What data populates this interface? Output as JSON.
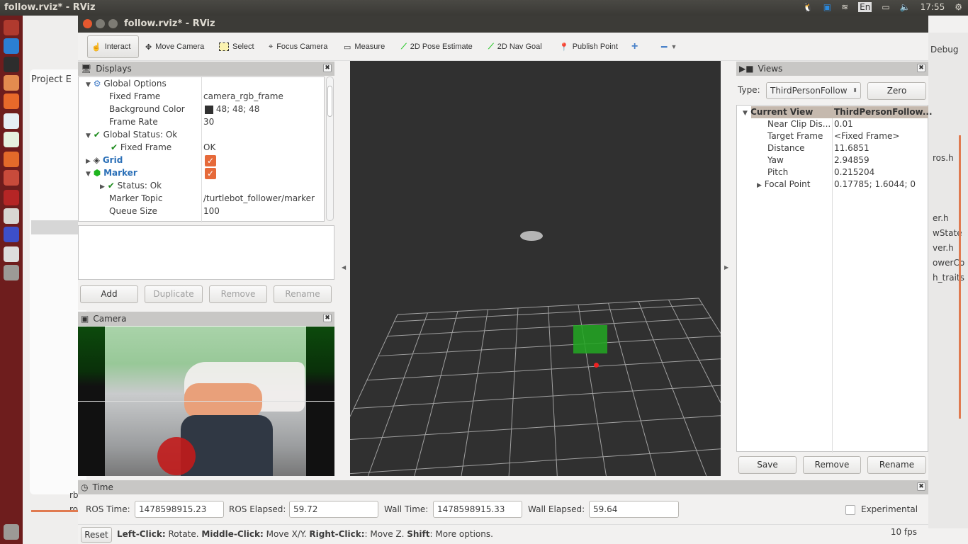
{
  "topbar": {
    "title": "follow.rviz* - RViz",
    "lang": "En",
    "clock": "17:55"
  },
  "window": {
    "title": "follow.rviz* - RViz"
  },
  "eclipse": {
    "project_label": "Project E",
    "debug_label": "Debug",
    "files": [
      "ros.h",
      "er.h",
      "wState",
      "ver.h",
      "owerCo",
      "h_traits",
      "rb",
      "ro"
    ]
  },
  "toolbar": {
    "tools": [
      {
        "label": "Interact",
        "icon": "hand-icon"
      },
      {
        "label": "Move Camera",
        "icon": "move-icon"
      },
      {
        "label": "Select",
        "icon": "select-icon"
      },
      {
        "label": "Focus Camera",
        "icon": "focus-icon"
      },
      {
        "label": "Measure",
        "icon": "ruler-icon"
      },
      {
        "label": "2D Pose Estimate",
        "icon": "green-arrow-icon"
      },
      {
        "label": "2D Nav Goal",
        "icon": "green-arrow-icon"
      },
      {
        "label": "Publish Point",
        "icon": "map-pin-icon"
      }
    ]
  },
  "displays": {
    "title": "Displays",
    "rows": [
      {
        "name": "Global Options",
        "value": ""
      },
      {
        "name": "Fixed Frame",
        "value": "camera_rgb_frame"
      },
      {
        "name": "Background Color",
        "value": "48; 48; 48"
      },
      {
        "name": "Frame Rate",
        "value": "30"
      },
      {
        "name": "Global Status: Ok",
        "value": ""
      },
      {
        "name": "Fixed Frame",
        "value": "OK"
      },
      {
        "name": "Grid",
        "value": ""
      },
      {
        "name": "Marker",
        "value": ""
      },
      {
        "name": "Status: Ok",
        "value": ""
      },
      {
        "name": "Marker Topic",
        "value": "/turtlebot_follower/marker"
      },
      {
        "name": "Queue Size",
        "value": "100"
      }
    ],
    "grid_enabled": true,
    "marker_enabled": true,
    "background_color": "#303030",
    "buttons": {
      "add": "Add",
      "duplicate": "Duplicate",
      "remove": "Remove",
      "rename": "Rename"
    }
  },
  "camera": {
    "title": "Camera"
  },
  "views": {
    "title": "Views",
    "type_label": "Type:",
    "type_value": "ThirdPersonFollow",
    "zero": "Zero",
    "header": {
      "name": "Current View",
      "value": "ThirdPersonFollow..."
    },
    "rows": [
      {
        "name": "Near Clip Dis...",
        "value": "0.01"
      },
      {
        "name": "Target Frame",
        "value": "<Fixed Frame>"
      },
      {
        "name": "Distance",
        "value": "11.6851"
      },
      {
        "name": "Yaw",
        "value": "2.94859"
      },
      {
        "name": "Pitch",
        "value": "0.215204"
      },
      {
        "name": "Focal Point",
        "value": "0.17785; 1.6044; 0"
      }
    ],
    "buttons": {
      "save": "Save",
      "remove": "Remove",
      "rename": "Rename"
    }
  },
  "time": {
    "title": "Time",
    "ros_time_label": "ROS Time:",
    "ros_time": "1478598915.23",
    "ros_elapsed_label": "ROS Elapsed:",
    "ros_elapsed": "59.72",
    "wall_time_label": "Wall Time:",
    "wall_time": "1478598915.33",
    "wall_elapsed_label": "Wall Elapsed:",
    "wall_elapsed": "59.64",
    "experimental": "Experimental"
  },
  "status": {
    "reset": "Reset",
    "k1": "Left-Click:",
    "v1": " Rotate. ",
    "k2": "Middle-Click:",
    "v2": " Move X/Y. ",
    "k3": "Right-Click:",
    "v3": ": Move Z. ",
    "k4": "Shift",
    "v4": ": More options.",
    "fps": "10 fps"
  }
}
